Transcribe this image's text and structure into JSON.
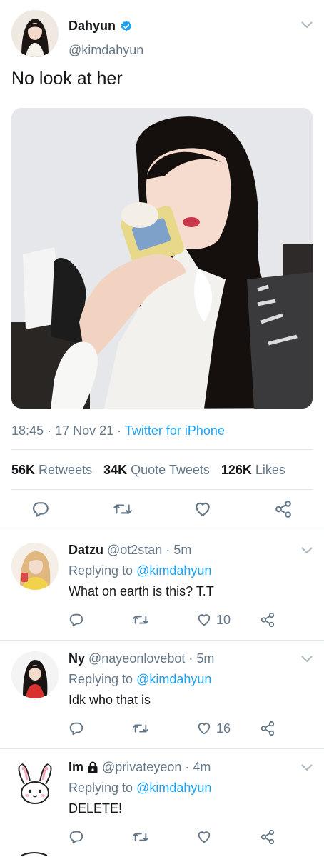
{
  "main_tweet": {
    "author_name": "Dahyun",
    "handle": "@kimdahyun",
    "text": "No look at her",
    "time": "18:45",
    "date": "17 Nov 21",
    "source": "Twitter for iPhone",
    "stats": [
      {
        "count": "56K",
        "label": "Retweets"
      },
      {
        "count": "34K",
        "label": "Quote Tweets"
      },
      {
        "count": "126K",
        "label": "Likes"
      }
    ]
  },
  "replies": [
    {
      "name": "Datzu",
      "handle": "@ot2stan",
      "age": "5m",
      "replying_label": "Replying to",
      "replying_to": "@kimdahyun",
      "text": "What on earth is this? T.T",
      "like_count": "10"
    },
    {
      "name": "Ny",
      "handle": "@nayeonlovebot",
      "age": "5m",
      "replying_label": "Replying to",
      "replying_to": "@kimdahyun",
      "text": "Idk who that is",
      "like_count": "16"
    },
    {
      "name": "Im",
      "handle": "@privateyeon",
      "age": "4m",
      "replying_label": "Replying to",
      "replying_to": "@kimdahyun",
      "text": "DELETE!",
      "like_count": ""
    }
  ],
  "colors": {
    "accent": "#1da1f2",
    "muted": "#657786",
    "text": "#14171a",
    "divider": "#e1e8ed"
  },
  "icons": [
    "verified-icon",
    "chevron-down-icon",
    "reply-icon",
    "retweet-icon",
    "like-icon",
    "share-icon",
    "lock-icon"
  ]
}
